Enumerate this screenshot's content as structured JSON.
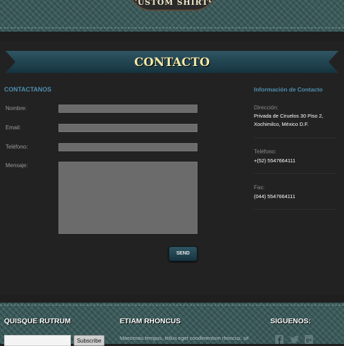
{
  "header": {
    "logo_text": "CUSTOM SHIRTS"
  },
  "page": {
    "title": "Contacto"
  },
  "contact_form": {
    "heading": "CONTACTANOS",
    "fields": [
      {
        "label": "Nombre:",
        "value": ""
      },
      {
        "label": "Email:",
        "value": ""
      },
      {
        "label": "Teléfono:",
        "value": ""
      },
      {
        "label": "Mensaje:",
        "value": ""
      }
    ],
    "send_label": "SEND"
  },
  "contact_info": {
    "heading": "Información de Contacto",
    "address_label": "Dirección:",
    "address_line1": "Privada de Ciruelos 30 Piso 2,",
    "address_line2": "Xochimilco, México D.F.",
    "phone_label": "Teléfono:",
    "phone_value": "+(52) 5547664111",
    "fax_label": "Fax:",
    "fax_value": "(044) 5547664111"
  },
  "footer": {
    "col1_heading": "QUISQUE RUTRUM",
    "subscribe_placeholder": "",
    "subscribe_label": "Subscribe",
    "col2_heading": "ETIAM RHONCUS",
    "col2_text": "Maecenas tempus, tellus eget condimentum rhoncus, sit",
    "col3_heading": "SIGUENOS:",
    "social_icons": [
      "facebook-icon",
      "twitter-icon",
      "google-plus-icon"
    ]
  }
}
